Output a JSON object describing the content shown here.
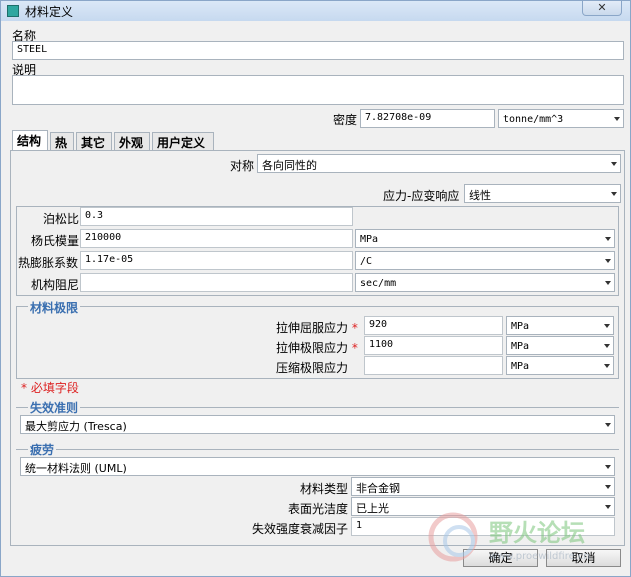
{
  "window": {
    "title": "材料定义",
    "close_label": "✕"
  },
  "name": {
    "label": "名称",
    "value": "STEEL"
  },
  "description": {
    "label": "说明",
    "value": ""
  },
  "density": {
    "label": "密度",
    "value": "7.82708e-09",
    "unit": "tonne/mm^3"
  },
  "tabs": [
    {
      "label": "结构"
    },
    {
      "label": "热"
    },
    {
      "label": "其它"
    },
    {
      "label": "外观"
    },
    {
      "label": "用户定义"
    }
  ],
  "structural": {
    "symmetry": {
      "label": "对称",
      "value": "各向同性的"
    },
    "stress_strain": {
      "label": "应力-应变响应",
      "value": "线性"
    },
    "poisson": {
      "label": "泊松比",
      "value": "0.3"
    },
    "youngs": {
      "label": "杨氏模量",
      "value": "210000",
      "unit": "MPa"
    },
    "thermal_exp": {
      "label": "热膨胀系数",
      "value": "1.17e-05",
      "unit": "/C"
    },
    "damping": {
      "label": "机构阻尼",
      "value": "",
      "unit": "sec/mm"
    },
    "limits": {
      "title": "材料极限",
      "tensile_yield": {
        "label": "拉伸屈服应力",
        "value": "920",
        "unit": "MPa"
      },
      "tensile_ultimate": {
        "label": "拉伸极限应力",
        "value": "1100",
        "unit": "MPa"
      },
      "compressive_ultimate": {
        "label": "压缩极限应力",
        "value": "",
        "unit": "MPa"
      }
    },
    "required_note": "* 必填字段",
    "required_mark": "*",
    "failure": {
      "title": "失效准则",
      "value": "最大剪应力 (Tresca)"
    },
    "fatigue": {
      "title": "疲劳",
      "method": "统一材料法则 (UML)",
      "material_type": {
        "label": "材料类型",
        "value": "非合金钢"
      },
      "surface_finish": {
        "label": "表面光洁度",
        "value": "已上光"
      },
      "strength_reduction": {
        "label": "失效强度衰减因子",
        "value": "1"
      }
    }
  },
  "buttons": {
    "ok": "确定",
    "cancel": "取消"
  },
  "watermark": {
    "text": "野火论坛",
    "url": "www.proewildfire.cn"
  },
  "colors": {
    "section_title": "#3a6fb0",
    "required": "#d22222",
    "watermark": "#7cc67c"
  }
}
